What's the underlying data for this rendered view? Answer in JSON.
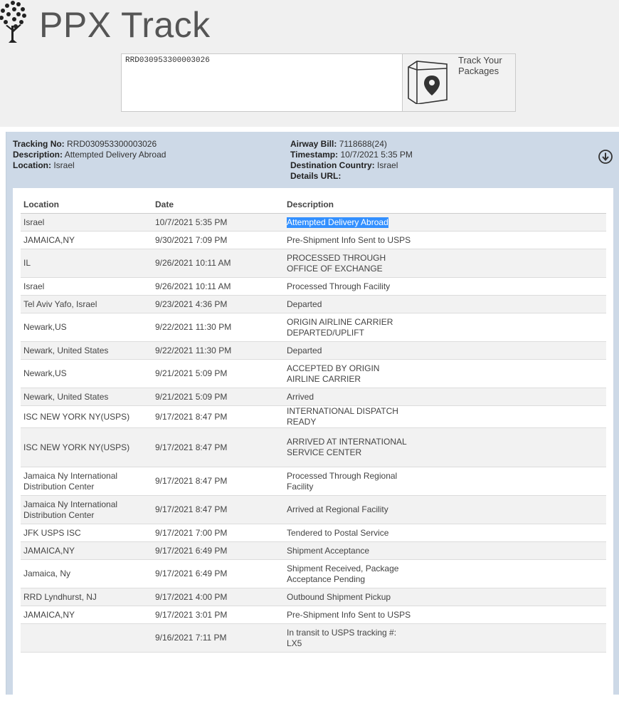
{
  "app": {
    "title": "PPX Track"
  },
  "search": {
    "value": "RRD030953300003026",
    "button_label": "Track Your Packages"
  },
  "summary": {
    "tracking_no_label": "Tracking No:",
    "tracking_no": "RRD030953300003026",
    "description_label": "Description:",
    "description": "Attempted Delivery Abroad",
    "location_label": "Location:",
    "location": "Israel",
    "airway_bill_label": "Airway Bill:",
    "airway_bill": "7118688(24)",
    "timestamp_label": "Timestamp:",
    "timestamp": "10/7/2021 5:35 PM",
    "destination_label": "Destination Country:",
    "destination": "Israel",
    "details_url_label": "Details URL:",
    "details_url": ""
  },
  "table": {
    "headers": [
      "Location",
      "Date",
      "Description"
    ],
    "rows": [
      {
        "location": "Israel",
        "date": "10/7/2021 5:35 PM",
        "description": "Attempted Delivery Abroad"
      },
      {
        "location": "JAMAICA,NY",
        "date": "9/30/2021 7:09 PM",
        "description": "Pre-Shipment Info Sent to USPS"
      },
      {
        "location": "IL",
        "date": "9/26/2021 10:11 AM",
        "description": "PROCESSED THROUGH OFFICE OF EXCHANGE"
      },
      {
        "location": "Israel",
        "date": "9/26/2021 10:11 AM",
        "description": "Processed Through Facility"
      },
      {
        "location": "Tel Aviv Yafo, Israel",
        "date": "9/23/2021 4:36 PM",
        "description": "Departed"
      },
      {
        "location": "Newark,US",
        "date": "9/22/2021 11:30 PM",
        "description": "ORIGIN AIRLINE CARRIER DEPARTED/UPLIFT"
      },
      {
        "location": "Newark, United States",
        "date": "9/22/2021 11:30 PM",
        "description": "Departed"
      },
      {
        "location": "Newark,US",
        "date": "9/21/2021 5:09 PM",
        "description": "ACCEPTED BY ORIGIN AIRLINE CARRIER"
      },
      {
        "location": "Newark, United States",
        "date": "9/21/2021 5:09 PM",
        "description": "Arrived"
      },
      {
        "location": "ISC NEW YORK NY(USPS)",
        "date": "9/17/2021 8:47 PM",
        "description": "INTERNATIONAL DISPATCH READY"
      },
      {
        "location": "ISC NEW YORK NY(USPS)",
        "date": "9/17/2021 8:47 PM",
        "description": "ARRIVED AT INTERNATIONAL SERVICE CENTER"
      },
      {
        "location": "Jamaica Ny International Distribution Center",
        "date": "9/17/2021 8:47 PM",
        "description": "Processed Through Regional Facility"
      },
      {
        "location": "Jamaica Ny International Distribution Center",
        "date": "9/17/2021 8:47 PM",
        "description": "Arrived at Regional Facility"
      },
      {
        "location": "JFK USPS ISC",
        "date": "9/17/2021 7:00 PM",
        "description": "Tendered to Postal Service"
      },
      {
        "location": "JAMAICA,NY",
        "date": "9/17/2021 6:49 PM",
        "description": "Shipment Acceptance"
      },
      {
        "location": "Jamaica, Ny",
        "date": "9/17/2021 6:49 PM",
        "description": "Shipment Received, Package Acceptance Pending"
      },
      {
        "location": "RRD Lyndhurst, NJ",
        "date": "9/17/2021 4:00 PM",
        "description": "Outbound Shipment Pickup"
      },
      {
        "location": "JAMAICA,NY",
        "date": "9/17/2021 3:01 PM",
        "description": "Pre-Shipment Info Sent to USPS"
      },
      {
        "location": "",
        "date": "9/16/2021 7:11 PM",
        "description": "In transit to USPS tracking #: LX5"
      }
    ]
  },
  "selected_row": 0,
  "colors": {
    "panel_bg": "#cdd9e7",
    "row_alt": "#f2f2f2",
    "selection": "#3390ff"
  },
  "icons": {
    "logo": "tree-dots-icon",
    "track": "package-location-icon",
    "expand": "circle-down-arrow-icon"
  }
}
